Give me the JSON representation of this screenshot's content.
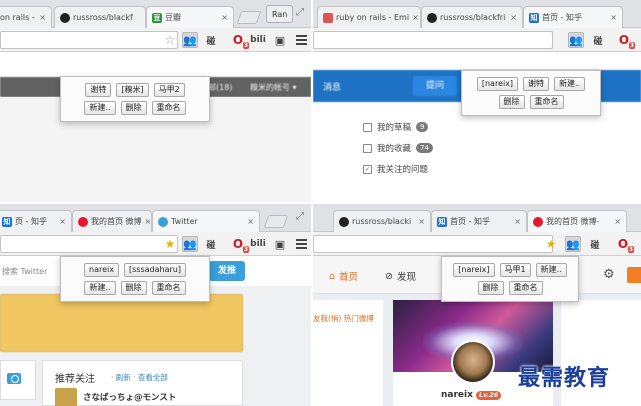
{
  "top_left": {
    "tabs": [
      {
        "title": "on rails - ",
        "favicon": "page-icon",
        "close": "×"
      },
      {
        "title": "russross/blackf",
        "favicon": "github-icon",
        "close": "×"
      },
      {
        "title": "豆瓣",
        "favicon": "douban-icon",
        "close": "×"
      }
    ],
    "profile_button": "Ran",
    "popup_rows": [
      [
        "谢特",
        "[糗米]",
        "马甲2"
      ],
      [
        "新建..",
        "删除",
        "重命名"
      ]
    ],
    "page_bar": {
      "left_text": "邮(18)",
      "right_text": "糗米的帐号 ▾"
    }
  },
  "top_right": {
    "tabs": [
      {
        "title": "ruby on rails - Emi",
        "favicon": "page-icon",
        "close": "×"
      },
      {
        "title": "russross/blackfri",
        "favicon": "github-icon",
        "close": "×"
      },
      {
        "title": "首页 - 知乎",
        "favicon": "zhihu-icon",
        "close": "×"
      }
    ],
    "popup_rows": [
      [
        "[nareix]",
        "谢特",
        "新建.."
      ],
      [
        "删除",
        "重命名"
      ]
    ],
    "header": {
      "messages": "消息",
      "ask": "提问"
    },
    "side_items": [
      {
        "label": "我的草稿",
        "count": "9"
      },
      {
        "label": "我的收藏",
        "count": "74"
      },
      {
        "label": "我关注的问题",
        "count": ""
      }
    ]
  },
  "bottom_left": {
    "tabs": [
      {
        "title": "页 - 知乎",
        "favicon": "zhihu-icon",
        "close": "×"
      },
      {
        "title": "我的首页 微博",
        "favicon": "weibo-icon",
        "close": "×"
      },
      {
        "title": "Twitter",
        "favicon": "twitter-icon",
        "close": "×"
      }
    ],
    "popup_rows": [
      [
        "nareix",
        "[sssadaharu]"
      ],
      [
        "新建..",
        "删除",
        "重命名"
      ]
    ],
    "search_placeholder": "搜索 Twitter",
    "tweet_button": "发推",
    "recommend": {
      "title": "推荐关注",
      "links": "· 刷新 · 查看全部",
      "user": "さなばっちょ@モンスト"
    }
  },
  "bottom_right": {
    "tabs": [
      {
        "title": "russross/blacki",
        "favicon": "github-icon",
        "close": "×"
      },
      {
        "title": "首页 - 知乎",
        "favicon": "zhihu-icon",
        "close": "×"
      },
      {
        "title": "我的首页 微博-",
        "favicon": "weibo-icon",
        "close": "×"
      }
    ],
    "popup_rows": [
      [
        "[nareix]",
        "马甲1",
        "新建.."
      ],
      [
        "删除",
        "重命名"
      ]
    ],
    "nav": {
      "home": "首页",
      "discover": "发现"
    },
    "left_links": "友我(悄)  热门微博",
    "profile": {
      "nickname": "nareix",
      "level": "Lv.26"
    }
  },
  "toolbar_text_icon": "碰",
  "toolbar_bili": "bili",
  "watermark": "最需教育"
}
